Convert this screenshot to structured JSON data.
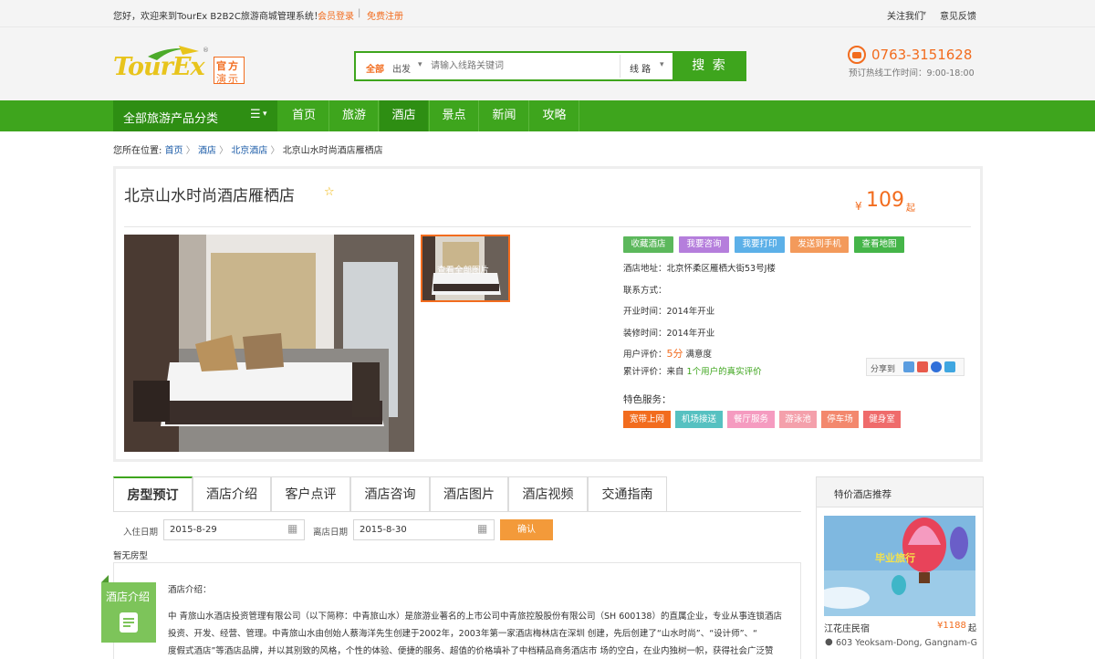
{
  "topbar": {
    "welcome": "您好，欢迎来到TourEx B2B2C旅游商城管理系统！",
    "login": "会员登录",
    "sep": "|",
    "register": "免费注册",
    "follow": "关注我们",
    "feedback": "意见反馈"
  },
  "logo": {
    "text": "TourEx",
    "badge": [
      "官方",
      "演示"
    ],
    "reg": "®"
  },
  "search": {
    "scope": "全部",
    "type": "出发",
    "placeholder": "请输入线路关键词",
    "category": "线 路",
    "button": "搜 索"
  },
  "hotline": {
    "number": "0763-3151628",
    "hours": "预订热线工作时间：9:00-18:00"
  },
  "nav": {
    "all_label": "全部旅游产品分类",
    "items": [
      "首页",
      "旅游",
      "酒店",
      "景点",
      "新闻",
      "攻略"
    ],
    "active_index": 2
  },
  "breadcrumb": {
    "prefix": "您所在位置:",
    "items": [
      "首页",
      "酒店",
      "北京酒店"
    ],
    "current": "北京山水时尚酒店雁栖店",
    "sep": "〉"
  },
  "hotel": {
    "name": "北京山水时尚酒店雁栖店",
    "price_symbol": "¥",
    "price": "109",
    "price_suffix": "起",
    "thumb_overlay": "查看全部图片",
    "actions": [
      {
        "label": "收藏酒店",
        "color": "#5cb85c"
      },
      {
        "label": "我要咨询",
        "color": "#b57edc"
      },
      {
        "label": "我要打印",
        "color": "#5cb0e8"
      },
      {
        "label": "发送到手机",
        "color": "#f39a5b"
      },
      {
        "label": "查看地图",
        "color": "#45b549"
      }
    ],
    "address_label": "酒店地址：",
    "address": "北京怀柔区雁栖大街53号J楼",
    "contact_label": "联系方式：",
    "contact": "",
    "opened_label": "开业时间：",
    "opened": "2014年开业",
    "renovated_label": "装修时间：",
    "renovated": "2014年开业",
    "rating_label": "用户评价：",
    "rating": "5分",
    "rating_suffix": "满意度",
    "reviews_label": "累计评价：来自",
    "reviews_count": "1个用户的真实评价",
    "share_label": "分享到",
    "services_label": "特色服务：",
    "services": [
      {
        "label": "宽带上网",
        "color": "#f26c1e"
      },
      {
        "label": "机场接送",
        "color": "#56c1c1"
      },
      {
        "label": "餐厅服务",
        "color": "#f59bc0"
      },
      {
        "label": "游泳池",
        "color": "#f4a0ab"
      },
      {
        "label": "停车场",
        "color": "#f3886d"
      },
      {
        "label": "健身室",
        "color": "#ef6b6b"
      }
    ]
  },
  "tabs": [
    "房型预订",
    "酒店介绍",
    "客户点评",
    "酒店咨询",
    "酒店图片",
    "酒店视频",
    "交通指南"
  ],
  "booking": {
    "checkin_label": "入住日期",
    "checkin": "2015-8-29",
    "checkout_label": "离店日期",
    "checkout": "2015-8-30",
    "confirm": "确认",
    "no_rooms": "暂无房型"
  },
  "intro": {
    "side_label": "酒店介绍",
    "title": "酒店介绍：",
    "lines": [
      "中 青旅山水酒店投资管理有限公司（以下简称：中青旅山水）是旅游业著名的上市公司中青旅控股股份有限公司（SH 600138）的直属企业，专业从事连锁酒店",
      "投资、开发、经营、管理。中青旅山水由创始人蔡海洋先生创建于2002年，2003年第一家酒店梅林店在深圳 创建，先后创建了“山水时尚”、“设计师”、“",
      "度假式酒店”等酒店品牌，并以其别致的风格，个性的体验、便捷的服务、超值的价格填补了中档精品商务酒店市 场的空白，在业内独树一帜，获得社会广泛赞"
    ]
  },
  "sidebar": {
    "title": "特价酒店推荐",
    "banner_text": "毕业旅行",
    "hotel_name": "江花庄民宿",
    "price": "¥1188",
    "price_suffix": "起",
    "address": "603 Yeoksam-Dong, Gangnam-G"
  }
}
